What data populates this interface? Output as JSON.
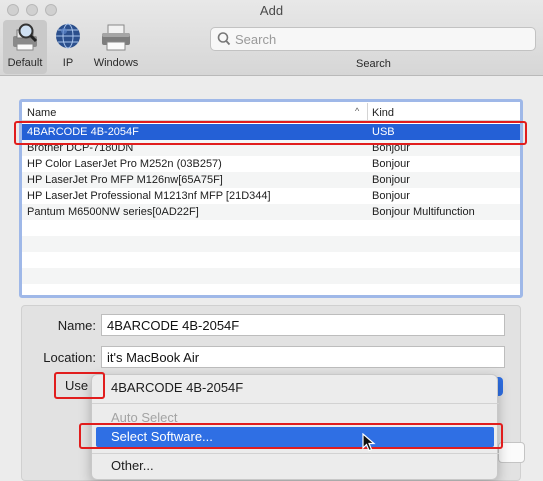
{
  "window": {
    "title": "Add"
  },
  "toolbar": {
    "buttons": [
      {
        "label": "Default",
        "icon": "printer-search-icon",
        "active": true
      },
      {
        "label": "IP",
        "icon": "globe-icon",
        "active": false
      },
      {
        "label": "Windows",
        "icon": "printer-icon",
        "active": false
      }
    ],
    "search": {
      "placeholder": "Search",
      "value": "",
      "label": "Search"
    }
  },
  "printer_list": {
    "columns": {
      "name": "Name",
      "kind": "Kind",
      "sort_indicator": "^"
    },
    "rows": [
      {
        "name": "4BARCODE 4B-2054F",
        "kind": "USB",
        "selected": true
      },
      {
        "name": "Brother DCP-7180DN",
        "kind": "Bonjour",
        "selected": false
      },
      {
        "name": "HP Color LaserJet Pro M252n (03B257)",
        "kind": "Bonjour",
        "selected": false
      },
      {
        "name": "HP LaserJet Pro MFP M126nw[65A75F]",
        "kind": "Bonjour",
        "selected": false
      },
      {
        "name": "HP LaserJet Professional M1213nf MFP [21D344]",
        "kind": "Bonjour",
        "selected": false
      },
      {
        "name": "Pantum M6500NW series[0AD22F]",
        "kind": "Bonjour Multifunction",
        "selected": false
      }
    ],
    "selection_color": "#2460d6"
  },
  "details": {
    "name_label": "Name:",
    "name_value": "4BARCODE 4B-2054F",
    "location_label": "Location:",
    "location_value": "it's MacBook Air",
    "use_label": "Use"
  },
  "use_menu": {
    "items": [
      {
        "label": "4BARCODE 4B-2054F",
        "state": "checked"
      },
      {
        "label": "Auto Select",
        "state": "disabled"
      },
      {
        "label": "Select Software...",
        "state": "highlighted"
      },
      {
        "label": "Other...",
        "state": "normal"
      }
    ],
    "highlight_color": "#2f6fe4"
  },
  "annotations": {
    "highlight_color": "#e11d1d"
  }
}
